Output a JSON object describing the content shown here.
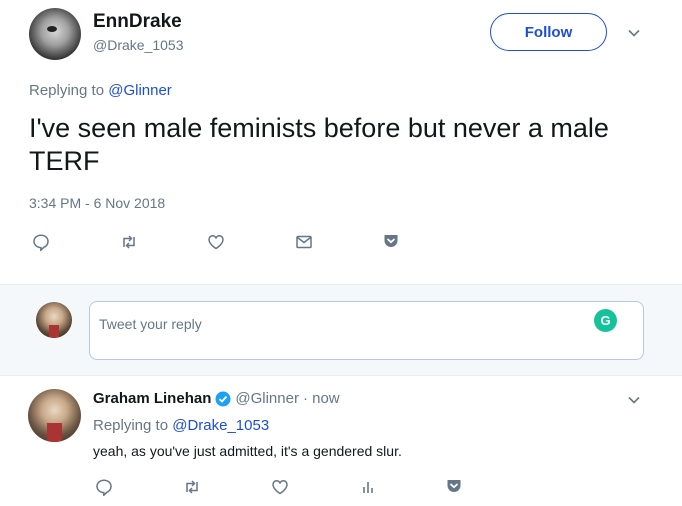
{
  "main_tweet": {
    "author_name": "EnnDrake",
    "author_handle": "@Drake_1053",
    "follow_label": "Follow",
    "replying_prefix": "Replying to",
    "replying_to": "@Glinner",
    "text": "I've seen male feminists before but never a male TERF",
    "timestamp": "3:34 PM - 6 Nov 2018",
    "actions": [
      "reply-icon",
      "retweet-icon",
      "like-icon",
      "message-icon",
      "pocket-icon"
    ]
  },
  "reply_box": {
    "placeholder": "Tweet your reply",
    "grammarly_letter": "G"
  },
  "reply_tweet": {
    "author_name": "Graham Linehan",
    "author_handle": "@Glinner",
    "time": "· now",
    "replying_prefix": "Replying to",
    "replying_to": "@Drake_1053",
    "text": "yeah, as you've just admitted, it's a gendered slur.",
    "actions": [
      "reply-icon",
      "retweet-icon",
      "like-icon",
      "analytics-icon",
      "pocket-icon"
    ]
  },
  "colors": {
    "accent": "#1d4ed8",
    "muted": "#657786",
    "text": "#14171a",
    "verified": "#1da1f2",
    "grammarly": "#15c39a"
  }
}
